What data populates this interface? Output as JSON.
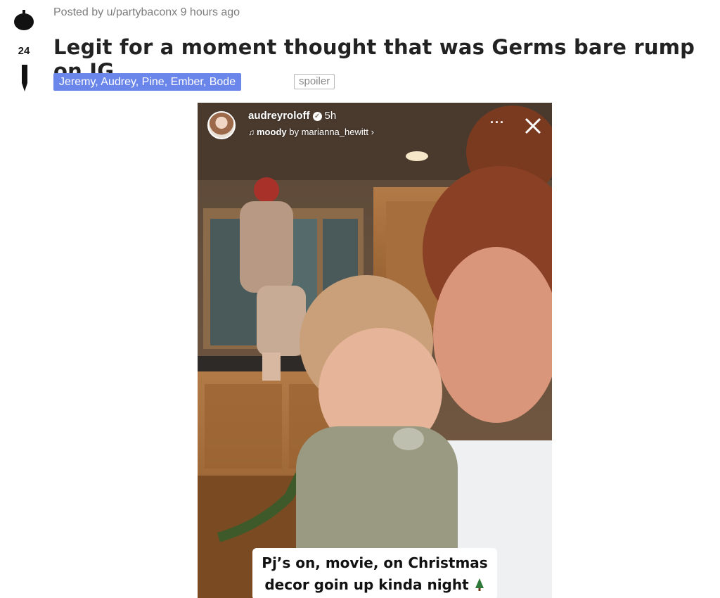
{
  "post": {
    "meta_prefix": "Posted by ",
    "author": "u/partybaconx",
    "time": " 9 hours ago",
    "score": "24",
    "title": "Legit for a moment thought that was Germs bare rump on IG.",
    "flair": "Jeremy, Audrey, Pine, Ember, Bode",
    "spoiler_tag": "spoiler"
  },
  "story": {
    "username": "audreyroloff",
    "time": "5h",
    "music_title": "moody",
    "music_by": " by marianna_hewitt ›",
    "more_label": "···",
    "caption_line1": "Pj’s on, movie, on Christmas",
    "caption_line2": "decor goin up kinda night"
  },
  "colors": {
    "flair_bg": "#6a86ea",
    "title": "#222222",
    "meta": "#7c7c7c"
  },
  "icons": {
    "upvote": "upvote-icon",
    "downvote": "downvote-icon",
    "verified": "verified-icon",
    "music": "music-icon",
    "more": "more-icon",
    "close": "close-icon",
    "tree": "christmas-tree-icon"
  }
}
